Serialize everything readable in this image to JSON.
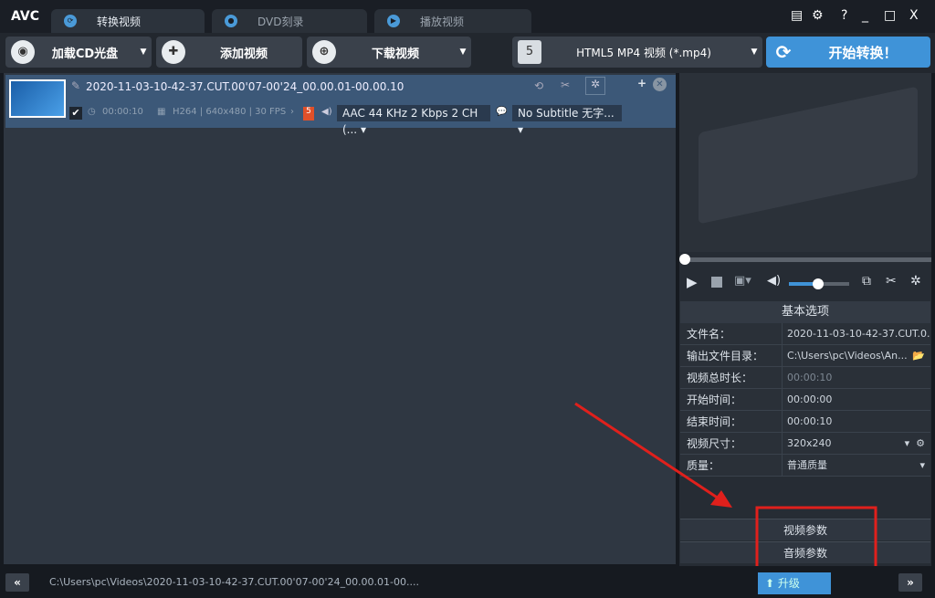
{
  "app": {
    "logo": "AVC"
  },
  "tabs": [
    {
      "label": "转换视频"
    },
    {
      "label": "DVD刻录"
    },
    {
      "label": "播放视频"
    }
  ],
  "window": {
    "help": "?",
    "minimize": "_",
    "maximize": "□",
    "close": "X"
  },
  "toolbar": {
    "load_cd": "加载CD光盘",
    "add_video": "添加视频",
    "download_video": "下载视频",
    "format": "HTML5 MP4 视频 (*.mp4)",
    "start": "开始转换！"
  },
  "file": {
    "name": "2020-11-03-10-42-37.CUT.00'07-00'24_00.00.01-00.00.10",
    "duration": "00:00:10",
    "video_info": "H264 | 640x480 | 30 FPS",
    "audio": "AAC 44 KHz 2 Kbps 2 CH (...",
    "subtitle": "No Subtitle 无字..."
  },
  "options": {
    "title": "基本选项",
    "rows": [
      {
        "key": "文件名：",
        "value": "2020-11-03-10-42-37.CUT.0..."
      },
      {
        "key": "输出文件目录：",
        "value": "C:\\Users\\pc\\Videos\\An..."
      },
      {
        "key": "视频总时长：",
        "value": "00:00:10"
      },
      {
        "key": "开始时间：",
        "value": "00:00:00"
      },
      {
        "key": "结束时间：",
        "value": "00:00:10"
      },
      {
        "key": "视频尺寸：",
        "value": "320x240"
      },
      {
        "key": "质量：",
        "value": "普通质量"
      }
    ],
    "video_params": "视频参数",
    "audio_params": "音频参数"
  },
  "player": {
    "volume": 0.55,
    "position": 0
  },
  "status": {
    "path": "C:\\Users\\pc\\Videos\\2020-11-03-10-42-37.CUT.00'07-00'24_00.00.01-00....",
    "upgrade": "升级"
  },
  "colors": {
    "accent": "#3f93d8",
    "annotation": "#e0201c"
  }
}
